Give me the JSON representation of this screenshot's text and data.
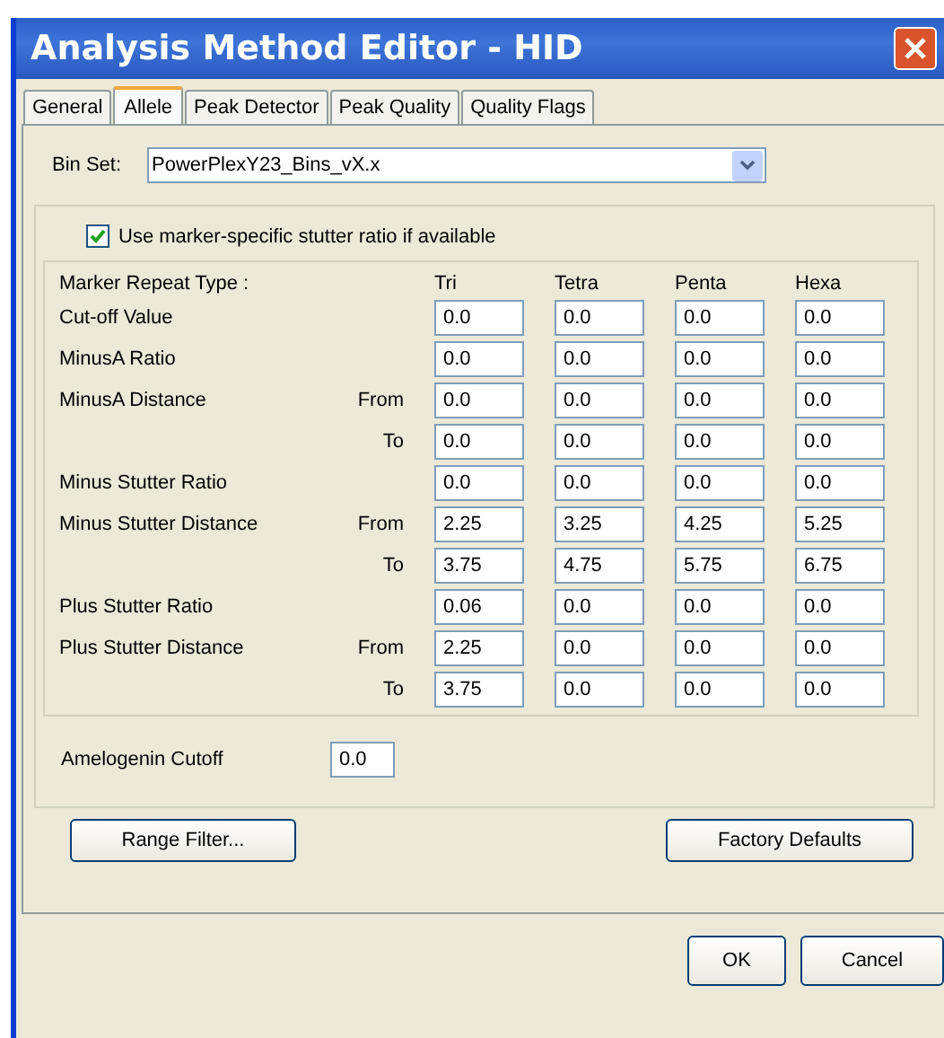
{
  "window": {
    "title": "Analysis Method Editor - HID"
  },
  "tabs": [
    {
      "label": "General",
      "selected": false
    },
    {
      "label": "Allele",
      "selected": true
    },
    {
      "label": "Peak Detector",
      "selected": false
    },
    {
      "label": "Peak Quality",
      "selected": false
    },
    {
      "label": "Quality Flags",
      "selected": false
    }
  ],
  "bin_set": {
    "label": "Bin Set:",
    "value": "PowerPlexY23_Bins_vX.x"
  },
  "marker_specific": {
    "label": "Use marker-specific stutter ratio if available",
    "checked": true
  },
  "table": {
    "header": "Marker Repeat Type :",
    "columns": [
      "Tri",
      "Tetra",
      "Penta",
      "Hexa"
    ],
    "rows": [
      {
        "label": "Cut-off Value",
        "values": [
          "0.0",
          "0.0",
          "0.0",
          "0.0"
        ]
      },
      {
        "label": "MinusA Ratio",
        "values": [
          "0.0",
          "0.0",
          "0.0",
          "0.0"
        ]
      },
      {
        "label": "MinusA Distance",
        "sublabel": "From",
        "values": [
          "0.0",
          "0.0",
          "0.0",
          "0.0"
        ]
      },
      {
        "sublabel": "To",
        "values": [
          "0.0",
          "0.0",
          "0.0",
          "0.0"
        ]
      },
      {
        "label": "Minus Stutter Ratio",
        "values": [
          "0.0",
          "0.0",
          "0.0",
          "0.0"
        ]
      },
      {
        "label": "Minus Stutter Distance",
        "sublabel": "From",
        "values": [
          "2.25",
          "3.25",
          "4.25",
          "5.25"
        ]
      },
      {
        "sublabel": "To",
        "values": [
          "3.75",
          "4.75",
          "5.75",
          "6.75"
        ]
      },
      {
        "label": "Plus Stutter Ratio",
        "values": [
          "0.06",
          "0.0",
          "0.0",
          "0.0"
        ]
      },
      {
        "label": "Plus Stutter Distance",
        "sublabel": "From",
        "values": [
          "2.25",
          "0.0",
          "0.0",
          "0.0"
        ]
      },
      {
        "sublabel": "To",
        "values": [
          "3.75",
          "0.0",
          "0.0",
          "0.0"
        ]
      }
    ]
  },
  "amelogenin": {
    "label": "Amelogenin Cutoff",
    "value": "0.0"
  },
  "buttons": [
    "Range Filter...",
    "Factory Defaults"
  ],
  "dialog_buttons": [
    "OK",
    "Cancel"
  ]
}
